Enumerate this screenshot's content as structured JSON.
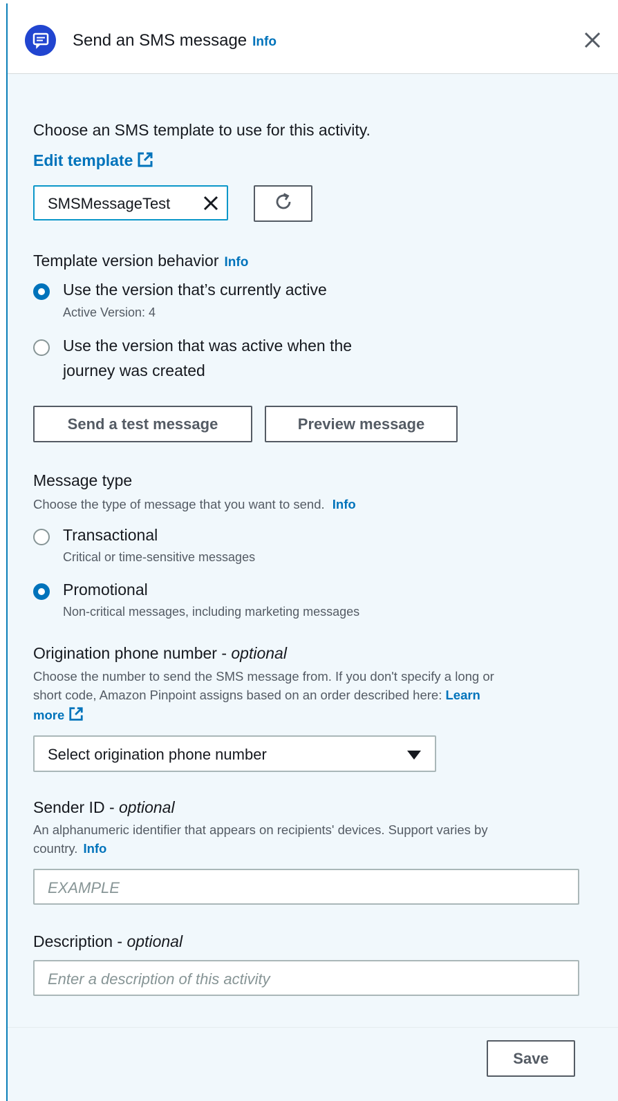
{
  "header": {
    "title": "Send an SMS message",
    "info": "Info",
    "icon": "sms-message-icon",
    "icon_color": "#2145d0"
  },
  "template": {
    "instruction": "Choose an SMS template to use for this activity.",
    "edit_link": "Edit template",
    "selected": "SMSMessageTest"
  },
  "version": {
    "label": "Template version behavior",
    "info": "Info",
    "options": [
      {
        "label": "Use the version that’s currently active",
        "sublabel": "Active Version: 4",
        "selected": true
      },
      {
        "label_line1": "Use the version that was active when the",
        "label_line2": "journey was created",
        "selected": false
      }
    ]
  },
  "buttons": {
    "send_test": "Send a test message",
    "preview": "Preview message"
  },
  "message_type": {
    "label": "Message type",
    "description": "Choose the type of message that you want to send.",
    "info": "Info",
    "options": [
      {
        "label": "Transactional",
        "sublabel": "Critical or time-sensitive messages",
        "selected": false
      },
      {
        "label": "Promotional",
        "sublabel": "Non-critical messages, including marketing messages",
        "selected": true
      }
    ]
  },
  "origination": {
    "label": "Origination phone number - ",
    "optional": "optional",
    "description_line1": "Choose the number to send the SMS message from. If you don't specify a long or",
    "description_line2": "short code, Amazon Pinpoint assigns based on an order described here: ",
    "learn": "Learn",
    "more": "more",
    "select_value": "Select origination phone number"
  },
  "sender_id": {
    "label": "Sender ID - ",
    "optional": "optional",
    "description_line1": "An alphanumeric identifier that appears on recipients' devices. Support varies by",
    "description_line2": "country.",
    "info": "Info",
    "placeholder": "EXAMPLE"
  },
  "description": {
    "label": "Description - ",
    "optional": "optional",
    "placeholder": "Enter a description of this activity"
  },
  "footer": {
    "save": "Save"
  },
  "colors": {
    "link": "#0073bb",
    "panel_bg": "#f1f8fc",
    "accent_border": "#0b97c9"
  }
}
